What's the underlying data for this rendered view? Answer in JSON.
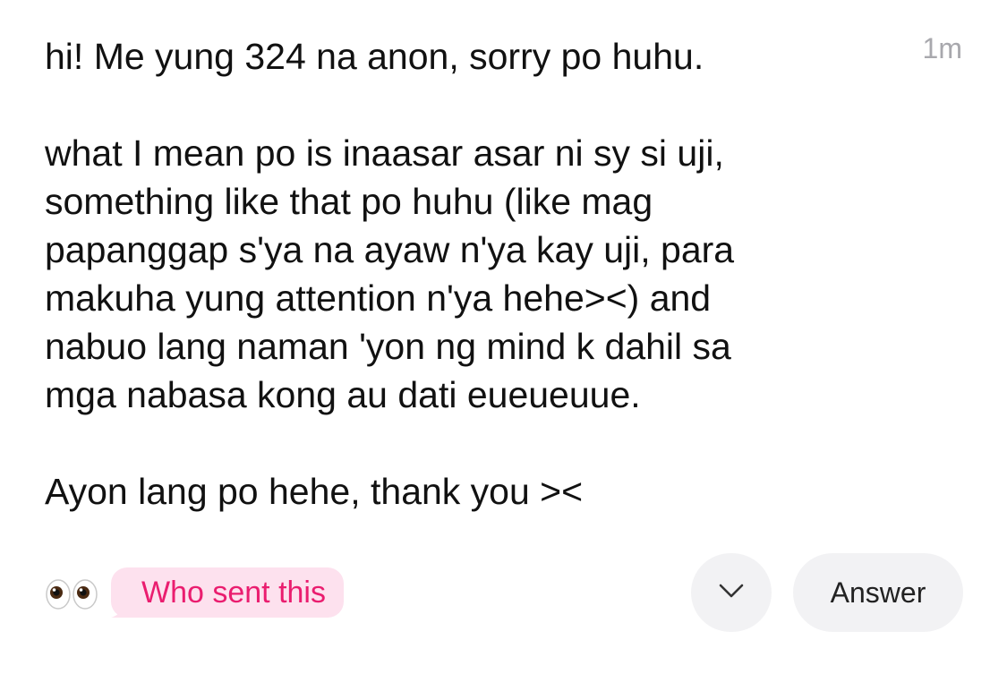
{
  "message": {
    "timestamp": "1m",
    "paragraphs": [
      "hi! Me yung 324 na anon, sorry po huhu.",
      "what I mean po is inaasar asar ni sy si uji,\nsomething like that po huhu (like mag\npapanggap s'ya na ayaw n'ya kay uji, para\nmakuha yung attention n'ya hehe><) and\nnabuo lang naman 'yon ng mind k dahil sa\nmga nabasa kong au dati eueueuue.",
      "Ayon lang po hehe, thank you ><"
    ]
  },
  "actions": {
    "reaction_icon": "eyes-icon",
    "who_sent_label": "Who sent this",
    "more_icon": "chevron-down-icon",
    "answer_label": "Answer"
  },
  "colors": {
    "pill_background": "#fde1ee",
    "pill_text": "#ea1d6f",
    "button_background": "#f2f2f4",
    "timestamp": "#a8a8ad"
  }
}
